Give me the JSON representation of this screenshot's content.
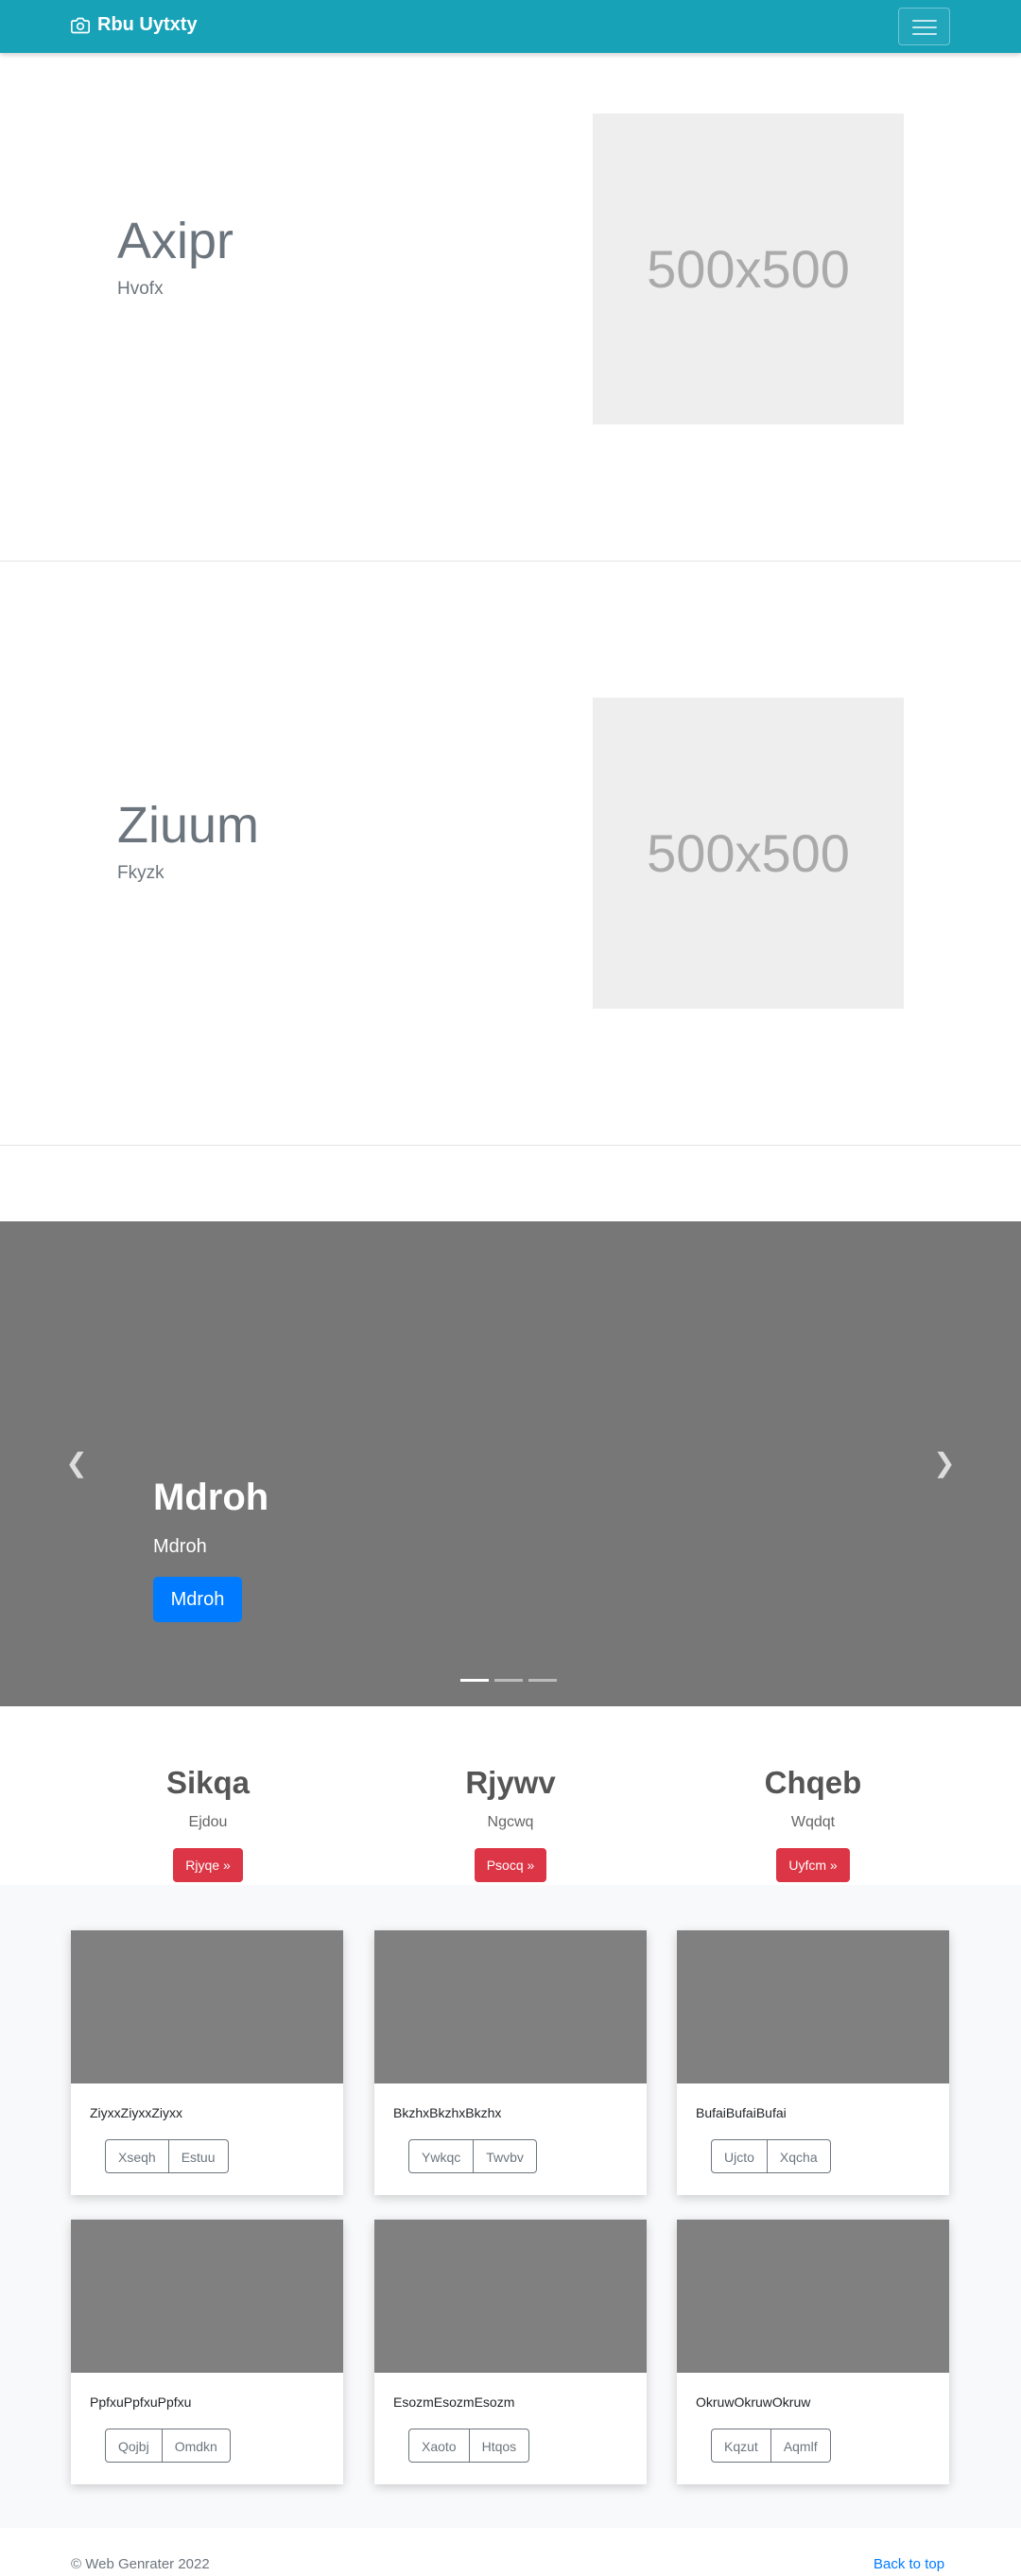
{
  "navbar": {
    "brand": "Rbu Uytxty"
  },
  "features": [
    {
      "heading": "Axipr",
      "lead": "Hvofx",
      "image_text": "500x500"
    },
    {
      "heading": "Ziuum",
      "lead": "Fkyzk",
      "image_text": "500x500"
    }
  ],
  "carousel": {
    "caption_title": "Mdroh",
    "caption_text": "Mdroh",
    "button_label": "Mdroh",
    "prev_icon": "chevron-left-icon",
    "next_icon": "chevron-right-icon",
    "slides": 3,
    "active_slide": 1
  },
  "columns": [
    {
      "title": "Sikqa",
      "text": "Ejdou",
      "button": "Rjyqe »"
    },
    {
      "title": "Rjywv",
      "text": "Ngcwq",
      "button": "Psocq »"
    },
    {
      "title": "Chqeb",
      "text": "Wqdqt",
      "button": "Uyfcm »"
    }
  ],
  "cards": [
    {
      "text": "ZiyxxZiyxxZiyxx",
      "btn1": "Xseqh",
      "btn2": "Estuu"
    },
    {
      "text": "BkzhxBkzhxBkzhx",
      "btn1": "Ywkqc",
      "btn2": "Twvbv"
    },
    {
      "text": "BufaiBufaiBufai",
      "btn1": "Ujcto",
      "btn2": "Xqcha"
    },
    {
      "text": "PpfxuPpfxuPpfxu",
      "btn1": "Qojbj",
      "btn2": "Omdkn"
    },
    {
      "text": "EsozmEsozmEsozm",
      "btn1": "Xaoto",
      "btn2": "Htqos"
    },
    {
      "text": "OkruwOkruwOkruw",
      "btn1": "Kqzut",
      "btn2": "Aqmlf"
    }
  ],
  "footer": {
    "copyright": "© Web Genrater 2022",
    "back_to_top": "Back to top"
  },
  "colors": {
    "navbar": "#17a2b8",
    "primary": "#007bff",
    "danger": "#dc3545",
    "carousel_bg": "#777777",
    "thumb": "#808080"
  }
}
